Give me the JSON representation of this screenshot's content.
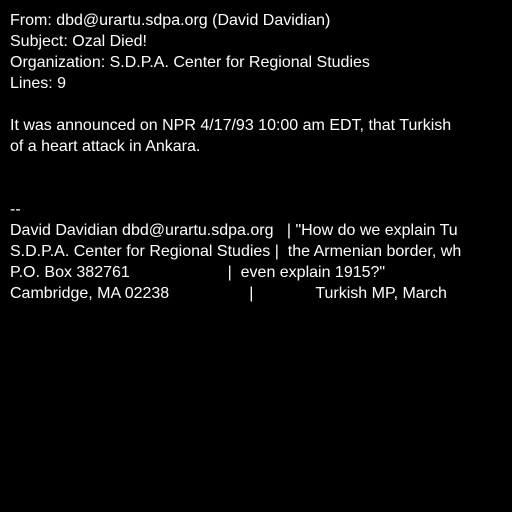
{
  "theme": {
    "background": "#000000",
    "text": "#FFFFFF"
  },
  "headers": {
    "from": "From: dbd@urartu.sdpa.org (David Davidian)",
    "subject": "Subject: Ozal Died!",
    "organization": "Organization: S.D.P.A. Center for Regional Studies",
    "lines": "Lines: 9"
  },
  "body": {
    "line1": "It was announced on NPR 4/17/93 10:00 am EDT, that Turkish",
    "line2": "of a heart attack in Ankara."
  },
  "signature": {
    "separator": "--",
    "line1": "David Davidian dbd@urartu.sdpa.org   | \"How do we explain Tu",
    "line2": "S.D.P.A. Center for Regional Studies |  the Armenian border, wh",
    "line3": "P.O. Box 382761                      |  even explain 1915?\"",
    "line4": "Cambridge, MA 02238                  |              Turkish MP, March"
  }
}
